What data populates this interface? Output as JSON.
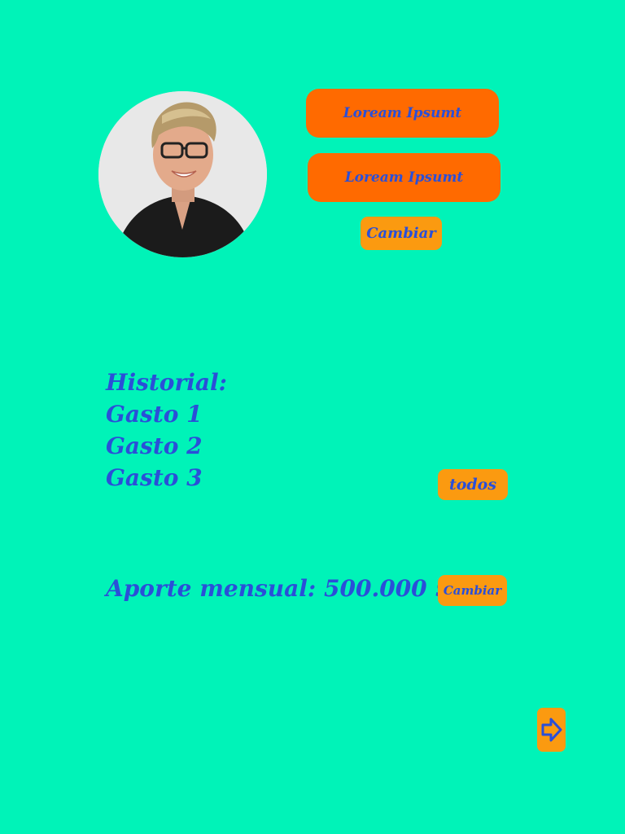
{
  "profile": {
    "buttons": [
      "Loream Ipsumt",
      "Loream Ipsumt"
    ],
    "change_label": "Cambiar"
  },
  "history": {
    "title": "Historial:",
    "items": [
      "Gasto 1",
      "Gasto 2",
      "Gasto 3"
    ],
    "all_label": "todos"
  },
  "contribution": {
    "text": "Aporte mensual: 500.000 $",
    "change_label": "Cambiar"
  },
  "icons": {
    "next": "arrow-right-icon"
  },
  "colors": {
    "background": "#00f3b8",
    "primary_button": "#ff6a00",
    "secondary_button": "#fb9a10",
    "text": "#2a4fd8"
  }
}
